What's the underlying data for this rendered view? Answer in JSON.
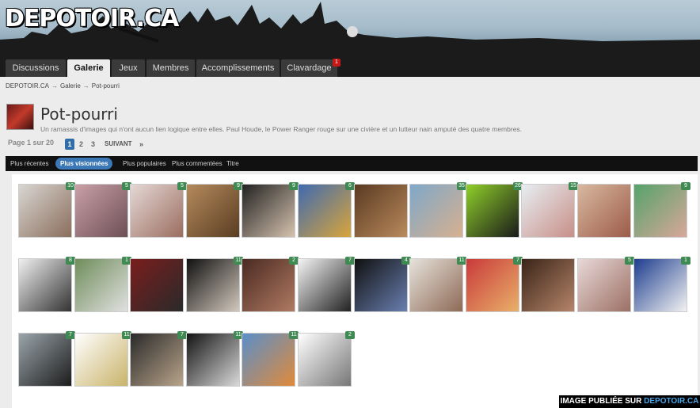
{
  "site": {
    "logo": "DEPOTOIR.CA"
  },
  "nav": {
    "tabs": [
      {
        "label": "Discussions",
        "active": false
      },
      {
        "label": "Galerie",
        "active": true
      },
      {
        "label": "Jeux",
        "active": false
      },
      {
        "label": "Membres",
        "active": false
      },
      {
        "label": "Accomplissements",
        "active": false
      },
      {
        "label": "Clavardage",
        "active": false,
        "badge": "1"
      }
    ]
  },
  "breadcrumb": [
    "DEPOTOIR.CA",
    "Galerie",
    "Pot-pourri"
  ],
  "page": {
    "title": "Pot-pourri",
    "subtitle": "Un ramassis d'images qui n'ont aucun lien logique entre elles. Paul Houde, le Power Ranger rouge sur une civière et un lutteur nain amputé des quatre membres."
  },
  "pagination": {
    "label": "Page 1 sur 20",
    "pages": [
      "1",
      "2",
      "3"
    ],
    "current": "1",
    "next": "SUIVANT",
    "last": "»"
  },
  "filters": [
    {
      "label": "Plus récentes",
      "active": false
    },
    {
      "label": "Plus visionnées",
      "active": true
    },
    {
      "label": "Plus populaires",
      "active": false
    },
    {
      "label": "Plus commentées",
      "active": false
    },
    {
      "label": "Titre",
      "active": false
    }
  ],
  "gallery": {
    "rows": [
      [
        {
          "count": "10",
          "colors": [
            "#d9d6d2",
            "#8a6e5c"
          ]
        },
        {
          "count": "5",
          "colors": [
            "#c9a0a6",
            "#6e4f57"
          ]
        },
        {
          "count": "5",
          "colors": [
            "#e5d8d6",
            "#9b6d5f"
          ]
        },
        {
          "count": "9",
          "colors": [
            "#b48a5c",
            "#5a3d22"
          ]
        },
        {
          "count": "9",
          "colors": [
            "#222222",
            "#d5c2ae"
          ]
        },
        {
          "count": "6",
          "colors": [
            "#3f6ab0",
            "#d9a53a"
          ]
        },
        {
          "count": "",
          "colors": [
            "#5a3a22",
            "#b98a5c"
          ]
        },
        {
          "count": "35",
          "colors": [
            "#7fa8c9",
            "#d7b08f"
          ]
        },
        {
          "count": "26",
          "colors": [
            "#8fcf2a",
            "#1a1a1a"
          ]
        },
        {
          "count": "15",
          "colors": [
            "#e7eef2",
            "#c88f88"
          ]
        },
        {
          "count": "",
          "colors": [
            "#d9b89f",
            "#9c5c4a"
          ]
        },
        {
          "count": "9",
          "colors": [
            "#55a36a",
            "#d9a79a"
          ]
        }
      ],
      [
        {
          "count": "8",
          "colors": [
            "#f0f0f0",
            "#333333"
          ]
        },
        {
          "count": "1",
          "colors": [
            "#6f8d5a",
            "#e0e0e0"
          ]
        },
        {
          "count": "",
          "colors": [
            "#7a1d1d",
            "#2a2a2a"
          ]
        },
        {
          "count": "11",
          "colors": [
            "#111111",
            "#d3c9bd"
          ]
        },
        {
          "count": "2",
          "colors": [
            "#4a2a22",
            "#b07a62"
          ]
        },
        {
          "count": "7",
          "colors": [
            "#f4f4f4",
            "#222222"
          ]
        },
        {
          "count": "4",
          "colors": [
            "#101010",
            "#6a7fb0"
          ]
        },
        {
          "count": "11",
          "colors": [
            "#e6e2dc",
            "#8e6a55"
          ]
        },
        {
          "count": "7",
          "colors": [
            "#c93a3a",
            "#e9b06a"
          ]
        },
        {
          "count": "",
          "colors": [
            "#3a2418",
            "#b58569"
          ]
        },
        {
          "count": "5",
          "colors": [
            "#e8d8d8",
            "#9c7064"
          ]
        },
        {
          "count": "1",
          "colors": [
            "#1d3d8e",
            "#f2f2f2"
          ]
        }
      ],
      [
        {
          "count": "7",
          "colors": [
            "#9aa5aa",
            "#1c1c1c"
          ]
        },
        {
          "count": "11",
          "colors": [
            "#ffffff",
            "#c9b36a"
          ]
        },
        {
          "count": "7",
          "colors": [
            "#2a2a2a",
            "#b9a48a"
          ]
        },
        {
          "count": "11",
          "colors": [
            "#141414",
            "#d9d9d9"
          ]
        },
        {
          "count": "11",
          "colors": [
            "#5a8fc9",
            "#e08a3a"
          ]
        },
        {
          "count": "2",
          "colors": [
            "#ffffff",
            "#777777"
          ]
        }
      ]
    ]
  },
  "stamp": {
    "prefix": "IMAGE PUBLIÉE SUR",
    "brand": "DEPOTOIR.CA"
  }
}
